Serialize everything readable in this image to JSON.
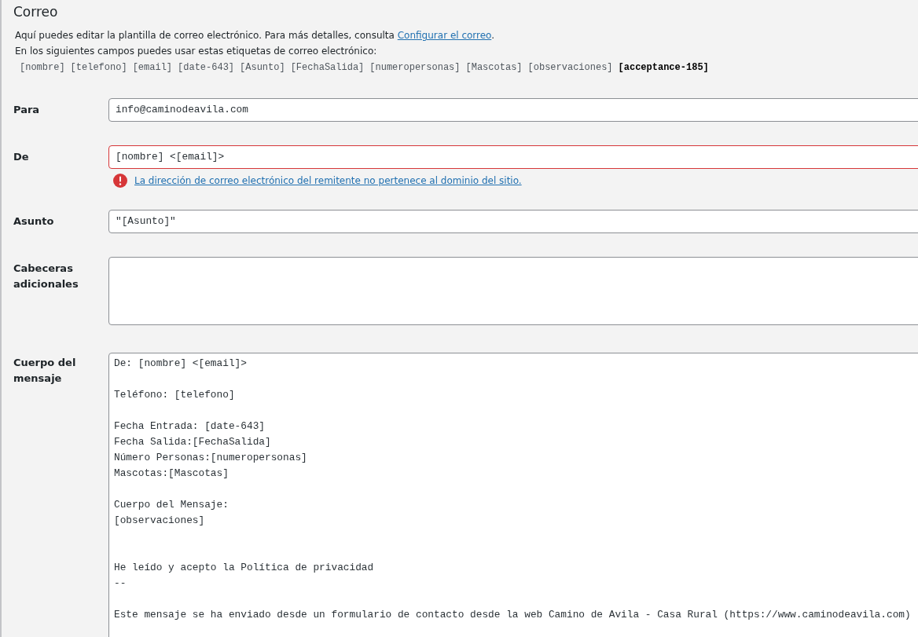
{
  "section_title": "Correo",
  "intro": {
    "text": "Aquí puedes editar la plantilla de correo electrónico. Para más detalles, consulta",
    "link": "Configurar el correo",
    "end": "."
  },
  "tags_intro": "En los siguientes campos puedes usar estas etiquetas de correo electrónico:",
  "tags": [
    {
      "text": "[nombre]",
      "required": false
    },
    {
      "text": "[telefono]",
      "required": false
    },
    {
      "text": "[email]",
      "required": false
    },
    {
      "text": "[date-643]",
      "required": false
    },
    {
      "text": "[Asunto]",
      "required": false
    },
    {
      "text": "[FechaSalida]",
      "required": false
    },
    {
      "text": "[numeropersonas]",
      "required": false
    },
    {
      "text": "[Mascotas]",
      "required": false
    },
    {
      "text": "[observaciones]",
      "required": false
    },
    {
      "text": "[acceptance-185]",
      "required": true
    }
  ],
  "fields": [
    {
      "label": "Para",
      "kind": "input",
      "value": "info@caminodeavila.com",
      "invalid": false
    },
    {
      "label": "De",
      "kind": "input",
      "value": "[nombre] <[email]>",
      "invalid": true,
      "error": "La dirección de correo electrónico del remitente no pertenece al dominio del sitio."
    },
    {
      "label": "Asunto",
      "kind": "input",
      "value": "\"[Asunto]\"",
      "invalid": false
    },
    {
      "label": "Cabeceras adicionales",
      "kind": "textarea",
      "invalid": false
    },
    {
      "label": "Cuerpo del mensaje",
      "kind": "body",
      "invalid": false,
      "value": "De: [nombre] <[email]>\n\nTeléfono: [telefono]\n\nFecha Entrada: [date-643]\nFecha Salida:[FechaSalida]\nNúmero Personas:[numeropersonas]\nMascotas:[Mascotas]\n\nCuerpo del Mensaje:\n[observaciones]\n\n\nHe leído y acepto la Política de privacidad\n--\n\nEste mensaje se ha enviado desde un formulario de contacto desde la web Camino de Avila - Casa Rural (https://www.caminodeavila.com)"
    }
  ]
}
